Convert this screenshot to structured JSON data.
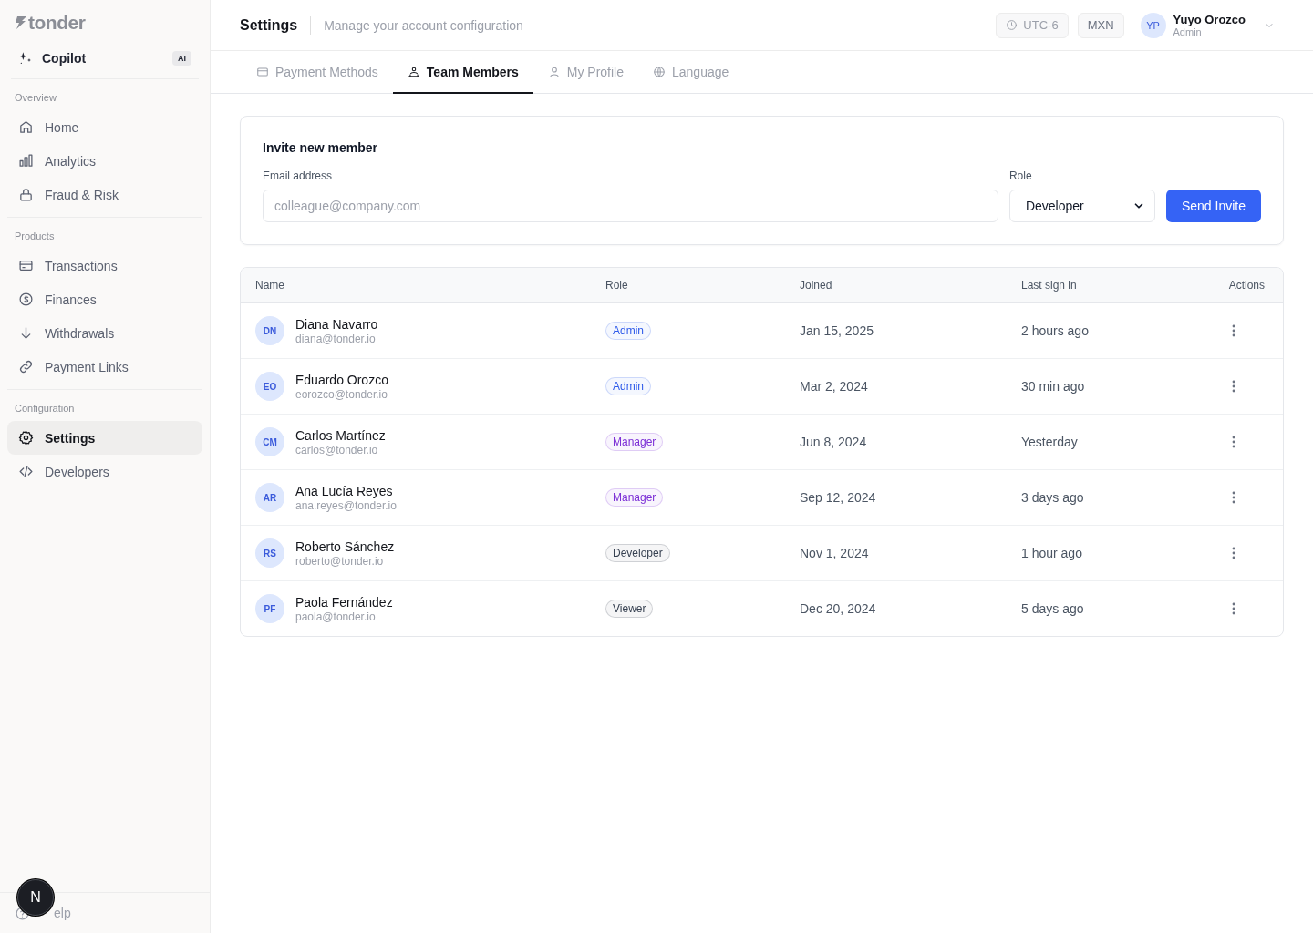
{
  "sidebar": {
    "logo": "tonder",
    "copilot": {
      "label": "Copilot",
      "badge": "AI"
    },
    "sections": [
      {
        "title": "Overview",
        "items": [
          {
            "label": "Home",
            "selected": false
          },
          {
            "label": "Analytics",
            "selected": false
          },
          {
            "label": "Fraud & Risk",
            "selected": false
          }
        ]
      },
      {
        "title": "Products",
        "items": [
          {
            "label": "Transactions",
            "selected": false
          },
          {
            "label": "Finances",
            "selected": false
          },
          {
            "label": "Withdrawals",
            "selected": false
          },
          {
            "label": "Payment Links",
            "selected": false
          }
        ]
      },
      {
        "title": "Configuration",
        "items": [
          {
            "label": "Settings",
            "selected": true
          },
          {
            "label": "Developers",
            "selected": false
          }
        ]
      }
    ],
    "help": "elp",
    "dev_badge": "N"
  },
  "header": {
    "title": "Settings",
    "subtitle": "Manage your account configuration",
    "timezone": "UTC-6",
    "currency": "MXN",
    "user": {
      "initials": "YP",
      "name": "Yuyo Orozco",
      "role": "Admin"
    }
  },
  "tabs": [
    {
      "label": "Payment Methods",
      "selected": false
    },
    {
      "label": "Team Members",
      "selected": true
    },
    {
      "label": "My Profile",
      "selected": false
    },
    {
      "label": "Language",
      "selected": false
    }
  ],
  "invite": {
    "title": "Invite new member",
    "email_label": "Email address",
    "email_placeholder": "colleague@company.com",
    "role_label": "Role",
    "role_value": "Developer",
    "button": "Send Invite"
  },
  "table": {
    "columns": [
      "Name",
      "Role",
      "Joined",
      "Last sign in",
      "Actions"
    ],
    "rows": [
      {
        "initials": "DN",
        "name": "Diana Navarro",
        "email": "diana@tonder.io",
        "role": {
          "label": "Admin",
          "color": "#2f5bea"
        },
        "joined": "Jan 15, 2025",
        "last_sign_in": "2 hours ago"
      },
      {
        "initials": "EO",
        "name": "Eduardo Orozco",
        "email": "eorozco@tonder.io",
        "role": {
          "label": "Admin",
          "color": "#2f5bea"
        },
        "joined": "Mar 2, 2024",
        "last_sign_in": "30 min ago"
      },
      {
        "initials": "CM",
        "name": "Carlos Martínez",
        "email": "carlos@tonder.io",
        "role": {
          "label": "Manager",
          "color": "#7c2fd6"
        },
        "joined": "Jun 8, 2024",
        "last_sign_in": "Yesterday"
      },
      {
        "initials": "AR",
        "name": "Ana Lucía Reyes",
        "email": "ana.reyes@tonder.io",
        "role": {
          "label": "Manager",
          "color": "#7c2fd6"
        },
        "joined": "Sep 12, 2024",
        "last_sign_in": "3 days ago"
      },
      {
        "initials": "RS",
        "name": "Roberto Sánchez",
        "email": "roberto@tonder.io",
        "role": {
          "label": "Developer",
          "color": "#374151"
        },
        "joined": "Nov 1, 2024",
        "last_sign_in": "1 hour ago"
      },
      {
        "initials": "PF",
        "name": "Paola Fernández",
        "email": "paola@tonder.io",
        "role": {
          "label": "Viewer",
          "color": "#374151"
        },
        "joined": "Dec 20, 2024",
        "last_sign_in": "5 days ago"
      }
    ]
  }
}
